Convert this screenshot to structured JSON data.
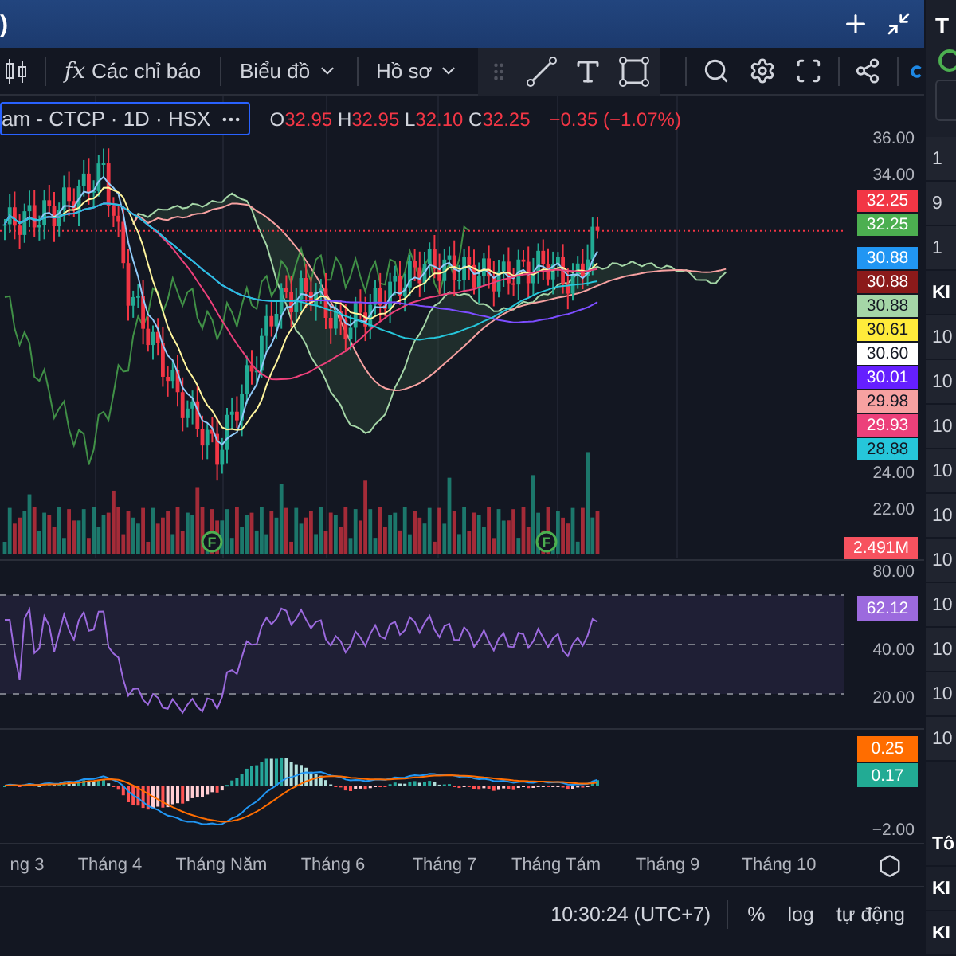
{
  "header": {
    "title": ")"
  },
  "toolbar": {
    "indicators_symbol": "fx",
    "indicators_label": "Các chỉ báo",
    "menus": [
      {
        "label": "Biểu đồ"
      },
      {
        "label": "Hồ sơ"
      }
    ]
  },
  "legend": {
    "symbol": "am - CTCP · 1D · HSX",
    "ohlc": [
      {
        "label": "O",
        "value": "32.95"
      },
      {
        "label": "H",
        "value": "32.95"
      },
      {
        "label": "L",
        "value": "32.10"
      },
      {
        "label": "C",
        "value": "32.25"
      }
    ],
    "change": "−0.35 (−1.07%)"
  },
  "price_axis": {
    "top_ticks": [
      "36.00",
      "34.00"
    ],
    "bottom_ticks": [
      "24.00",
      "22.00"
    ],
    "badges": [
      {
        "value": "32.25",
        "color": "#f23645"
      },
      {
        "value": "32.25",
        "color": "#4caf50"
      },
      {
        "value": "30.88",
        "color": "#2196f3"
      },
      {
        "value": "30.88",
        "color": "#8b1a1a"
      },
      {
        "value": "30.88",
        "color": "#a5d6a7"
      },
      {
        "value": "30.61",
        "color": "#ffeb3b"
      },
      {
        "value": "30.60",
        "color": "#ffffff"
      },
      {
        "value": "30.01",
        "color": "#651fff"
      },
      {
        "value": "29.98",
        "color": "#f7a1a1"
      },
      {
        "value": "29.93",
        "color": "#ec407a"
      },
      {
        "value": "28.88",
        "color": "#26c6da"
      }
    ],
    "volume_badge": {
      "value": "2.491M",
      "color": "#f7525f"
    }
  },
  "event_markers": [
    {
      "label": "F"
    },
    {
      "label": "F"
    }
  ],
  "rsi": {
    "ticks": [
      "80.00",
      "40.00",
      "20.00"
    ],
    "badge": {
      "value": "62.12",
      "color": "#9c6ade"
    }
  },
  "macd": {
    "badges": [
      {
        "value": "0.25",
        "color": "#ff6d00"
      },
      {
        "value": "0.17",
        "color": "#22ab94"
      }
    ],
    "ticks": [
      "−2.00"
    ]
  },
  "time_axis": [
    "ng 3",
    "Tháng 4",
    "Tháng Năm",
    "Tháng 6",
    "Tháng 7",
    "Tháng Tám",
    "Tháng 9",
    "Tháng 10"
  ],
  "status_bar": {
    "time": "10:30:24 (UTC+7)",
    "options": [
      "%",
      "log",
      "tự động"
    ]
  },
  "sidebar": {
    "title": "T",
    "rows": [
      {
        "text": "1",
        "kind": "value"
      },
      {
        "text": "9",
        "kind": "value"
      },
      {
        "text": "1",
        "kind": "value"
      },
      {
        "text": "KI",
        "kind": "header"
      },
      {
        "text": "10",
        "kind": "value"
      },
      {
        "text": "10",
        "kind": "value"
      },
      {
        "text": "10",
        "kind": "value"
      },
      {
        "text": "10",
        "kind": "value"
      },
      {
        "text": "10",
        "kind": "value"
      },
      {
        "text": "10",
        "kind": "value"
      },
      {
        "text": "10",
        "kind": "value"
      },
      {
        "text": "10",
        "kind": "value"
      },
      {
        "text": "10",
        "kind": "value"
      },
      {
        "text": "10",
        "kind": "value"
      }
    ],
    "footer": [
      {
        "text": "Tô"
      },
      {
        "text": "KI"
      },
      {
        "text": "KI"
      }
    ]
  }
}
